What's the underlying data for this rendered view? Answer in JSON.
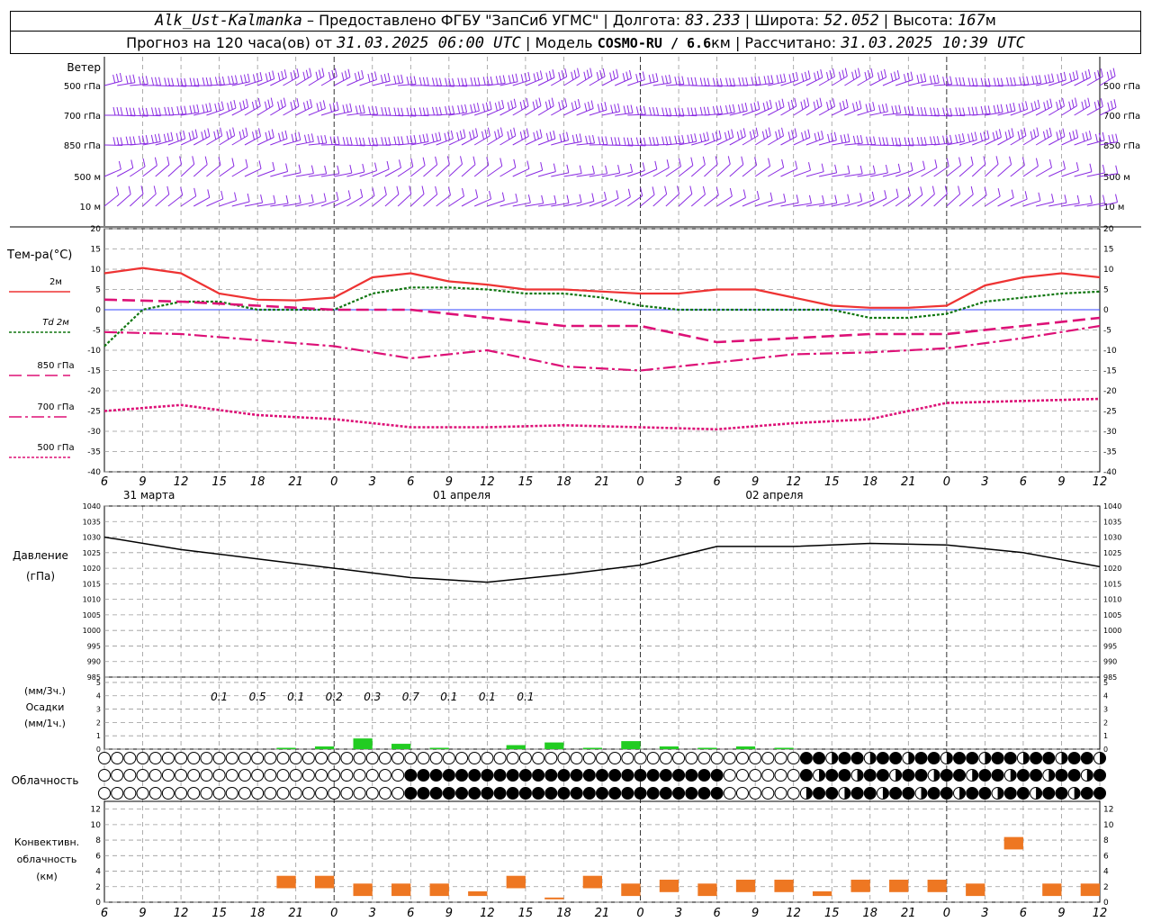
{
  "header": {
    "station": "Alk_Ust-Kalmanka",
    "dash": "–",
    "provider": "Предоставлено ФГБУ \"ЗапСиб УГМС\"",
    "lon_label": "Долгота:",
    "lon": "83.233",
    "lat_label": "Широта:",
    "lat": "52.052",
    "alt_label": "Высота:",
    "alt": "167",
    "alt_unit": "м",
    "forecast_label": "Прогноз на 120 часа(ов) от",
    "issue_time": "31.03.2025 06:00 UTC",
    "model_label": "Модель",
    "model": "COSMO-RU / 6.6",
    "model_unit": "км",
    "calc_label": "Рассчитано:",
    "calc_time": "31.03.2025 10:39 UTC"
  },
  "colors": {
    "wind": "#8a2be2",
    "t2m": "#ee3333",
    "td2m": "#117711",
    "t850": "#dd1177",
    "pressure": "#000000",
    "precip": "#22cc22",
    "convective": "#ee7722",
    "grid": "#999999",
    "zero_line": "#3344ff"
  },
  "x_axis": {
    "hours": [
      "6",
      "9",
      "12",
      "15",
      "18",
      "21",
      "0",
      "3",
      "6",
      "9",
      "12",
      "15",
      "18",
      "21",
      "0",
      "3",
      "6",
      "9",
      "12",
      "15",
      "18",
      "21",
      "0",
      "3",
      "6",
      "9",
      "12"
    ],
    "day_labels": [
      "31 марта",
      "01 апреля",
      "02 апреля"
    ]
  },
  "wind_panel": {
    "title": "Ветер",
    "levels": [
      "500 гПа",
      "700 гПа",
      "850 гПа",
      "500 м",
      "10 м"
    ]
  },
  "temp_panel": {
    "title": "Тем-ра(°C)",
    "legend": [
      {
        "key": "t2m",
        "label": "2м"
      },
      {
        "key": "td2m",
        "label": "Td  2м"
      },
      {
        "key": "t850",
        "label": "850 гПа"
      },
      {
        "key": "t700",
        "label": "700 гПа"
      },
      {
        "key": "t500",
        "label": "500 гПа"
      }
    ],
    "yticks": [
      "20",
      "15",
      "10",
      "5",
      "0",
      "-5",
      "-10",
      "-15",
      "-20",
      "-25",
      "-30",
      "-35",
      "-40"
    ]
  },
  "pressure_panel": {
    "title": "Давление",
    "unit": "(гПа)",
    "yticks": [
      "1040",
      "1035",
      "1030",
      "1025",
      "1020",
      "1015",
      "1010",
      "1005",
      "1000",
      "995",
      "990",
      "985"
    ]
  },
  "precip_panel": {
    "unit3": "(мм/3ч.)",
    "title": "Осадки",
    "unit1": "(мм/1ч.)",
    "yticks": [
      "5",
      "4",
      "3",
      "2",
      "1",
      "0"
    ],
    "labels": [
      {
        "t": 9,
        "v": "0.1"
      },
      {
        "t": 12,
        "v": "0.5"
      },
      {
        "t": 15,
        "v": "0.1"
      },
      {
        "t": 18,
        "v": "0.2"
      },
      {
        "t": 21,
        "v": "0.3"
      },
      {
        "t": 24,
        "v": "0.7"
      },
      {
        "t": 27,
        "v": "0.1"
      },
      {
        "t": 30,
        "v": "0.1"
      },
      {
        "t": 33,
        "v": "0.1"
      }
    ]
  },
  "cloud_panel": {
    "title": "Облачность"
  },
  "conv_panel": {
    "title1": "Конвективн.",
    "title2": "облачность",
    "unit": "(км)",
    "yticks": [
      "12",
      "10",
      "8",
      "6",
      "4",
      "2",
      "0"
    ]
  },
  "chart_data": {
    "type": "line",
    "x_unit": "hours since 31.03.2025 06:00 UTC",
    "x_range": [
      0,
      78
    ],
    "series": [
      {
        "name": "2м",
        "key": "t2m",
        "x": [
          0,
          3,
          6,
          9,
          12,
          15,
          18,
          21,
          24,
          27,
          30,
          33,
          36,
          39,
          42,
          45,
          48,
          51,
          54,
          57,
          60,
          63,
          66,
          69,
          72,
          75,
          78
        ],
        "values": [
          9,
          10.3,
          9,
          4,
          2.5,
          2.3,
          3,
          8,
          9,
          7,
          6.2,
          5,
          5,
          4.5,
          4,
          4,
          5,
          5,
          3,
          1,
          0.5,
          0.5,
          1,
          6,
          8,
          9,
          8
        ]
      },
      {
        "name": "Td  2м",
        "key": "td2m",
        "x": [
          0,
          3,
          6,
          9,
          12,
          15,
          18,
          21,
          24,
          27,
          30,
          33,
          36,
          39,
          42,
          45,
          48,
          51,
          54,
          57,
          60,
          63,
          66,
          69,
          72,
          75,
          78
        ],
        "values": [
          -9,
          0,
          2,
          2,
          0,
          0,
          0,
          4,
          5.5,
          5.5,
          5,
          4,
          4,
          3,
          1,
          0,
          0,
          0,
          0,
          0,
          -2,
          -2,
          -1,
          2,
          3,
          4,
          4.5
        ]
      },
      {
        "name": "850 гПа",
        "key": "t850",
        "x": [
          0,
          6,
          12,
          18,
          24,
          30,
          36,
          42,
          48,
          54,
          60,
          66,
          72,
          78
        ],
        "values": [
          2.5,
          2,
          1,
          0,
          0,
          -2,
          -4,
          -4,
          -8,
          -7,
          -6,
          -6,
          -4,
          -2
        ]
      },
      {
        "name": "700 гПа",
        "key": "t700",
        "x": [
          0,
          6,
          12,
          18,
          24,
          30,
          36,
          42,
          48,
          54,
          60,
          66,
          72,
          78
        ],
        "values": [
          -5.5,
          -6,
          -7.5,
          -9,
          -12,
          -10,
          -14,
          -15,
          -13,
          -11,
          -10.5,
          -9.5,
          -7,
          -4
        ]
      },
      {
        "name": "500 гПа",
        "key": "t500",
        "x": [
          0,
          6,
          12,
          18,
          24,
          30,
          36,
          42,
          48,
          54,
          60,
          66,
          72,
          78
        ],
        "values": [
          -25,
          -23.5,
          -26,
          -27,
          -29,
          -29,
          -28.5,
          -29,
          -29.5,
          -28,
          -27,
          -23,
          -22.5,
          -22
        ]
      },
      {
        "name": "Давление",
        "key": "pressure",
        "x": [
          0,
          6,
          12,
          18,
          24,
          30,
          36,
          42,
          48,
          54,
          60,
          66,
          72,
          78
        ],
        "values": [
          1030,
          1026,
          1023,
          1020,
          1017,
          1015.5,
          1018,
          1021,
          1027,
          1027,
          1028,
          1027.5,
          1025,
          1020.5
        ]
      }
    ],
    "precip_bars": {
      "x": [
        15,
        18,
        21,
        24,
        27,
        30,
        33,
        36,
        39,
        42,
        45,
        48,
        51,
        54
      ],
      "values": [
        0.1,
        0.2,
        0.8,
        0.4,
        0.1,
        0,
        0.3,
        0.5,
        0.1,
        0.6,
        0.2,
        0.1,
        0.2,
        0.1
      ]
    },
    "convective_bars": {
      "x": [
        15,
        18,
        21,
        24,
        27,
        30,
        33,
        36,
        39,
        42,
        45,
        48,
        51,
        54,
        57,
        60,
        63,
        66,
        69,
        72,
        75,
        78
      ],
      "values": [
        3,
        3,
        2,
        2,
        2,
        1,
        3,
        0.2,
        3,
        2,
        2.5,
        2,
        2.5,
        2.5,
        1,
        2.5,
        2.5,
        2.5,
        2,
        8,
        2,
        2
      ]
    },
    "ylim_temp": [
      -40,
      20
    ],
    "ylim_pressure": [
      985,
      1040
    ],
    "ylim_precip": [
      0,
      5
    ],
    "ylim_conv": [
      0,
      13
    ]
  }
}
